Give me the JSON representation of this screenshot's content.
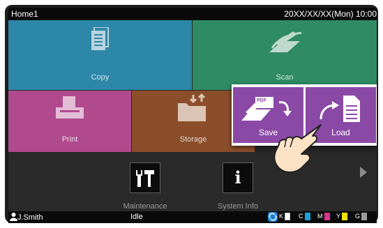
{
  "titlebar": {
    "screen_name": "Home1",
    "datetime": "20XX/XX/XX(Mon) 10:00"
  },
  "tiles": {
    "copy": "Copy",
    "scan": "Scan",
    "print": "Print",
    "storage": "Storage"
  },
  "popup": {
    "save": "Save",
    "load": "Load",
    "pdf_badge": "PDF"
  },
  "functions": {
    "maintenance": "Maintenance",
    "system_info": "System Info"
  },
  "status": {
    "user": "J.Smith",
    "printer_state": "Idle",
    "toner": [
      {
        "label": "K",
        "color": "#ffffff"
      },
      {
        "label": "C",
        "color": "#1aa0d8"
      },
      {
        "label": "M",
        "color": "#d8338e"
      },
      {
        "label": "Y",
        "color": "#f2e200"
      },
      {
        "label": "G",
        "color": "#9a9a9a"
      }
    ]
  },
  "icons": {
    "copy": "document-copy-icon",
    "scan": "scanner-icon",
    "print": "printer-icon",
    "storage": "folder-arrows-icon",
    "save": "pdf-save-icon",
    "load": "document-load-icon",
    "maintenance": "tools-icon",
    "system_info": "info-icon",
    "user": "user-icon",
    "network": "network-icon",
    "next": "next-arrow-icon",
    "hand": "pointing-hand-icon"
  }
}
